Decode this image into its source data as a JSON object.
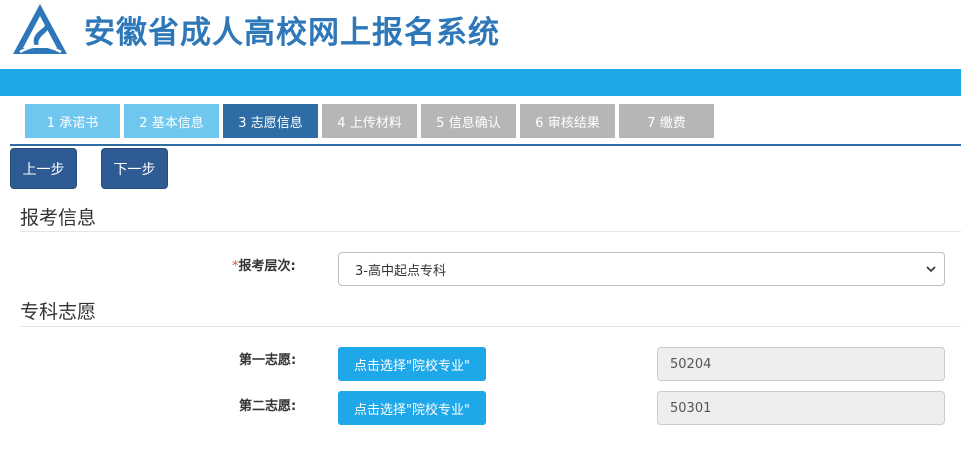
{
  "header": {
    "title": "安徽省成人高校网上报名系统",
    "logo_icon": "logo-triangle-icon",
    "brand_color": "#2e78b9",
    "bar_color": "#1fa8e9"
  },
  "steps": [
    {
      "label": "1 承诺书",
      "state": "done"
    },
    {
      "label": "2 基本信息",
      "state": "done"
    },
    {
      "label": "3 志愿信息",
      "state": "active"
    },
    {
      "label": "4 上传材料",
      "state": "todo"
    },
    {
      "label": "5 信息确认",
      "state": "todo"
    },
    {
      "label": "6 审核结果",
      "state": "todo"
    },
    {
      "label": "7 缴费",
      "state": "todo"
    }
  ],
  "nav": {
    "prev_label": "上一步",
    "next_label": "下一步"
  },
  "exam_info": {
    "section_title": "报考信息",
    "required_mark": "*",
    "level_label": "报考层次:",
    "level_value": "3-高中起点专科"
  },
  "wishes": {
    "section_title": "专科志愿",
    "items": [
      {
        "label": "第一志愿:",
        "button_label": "点击选择\"院校专业\"",
        "value": "50204"
      },
      {
        "label": "第二志愿:",
        "button_label": "点击选择\"院校专业\"",
        "value": "50301"
      }
    ]
  }
}
